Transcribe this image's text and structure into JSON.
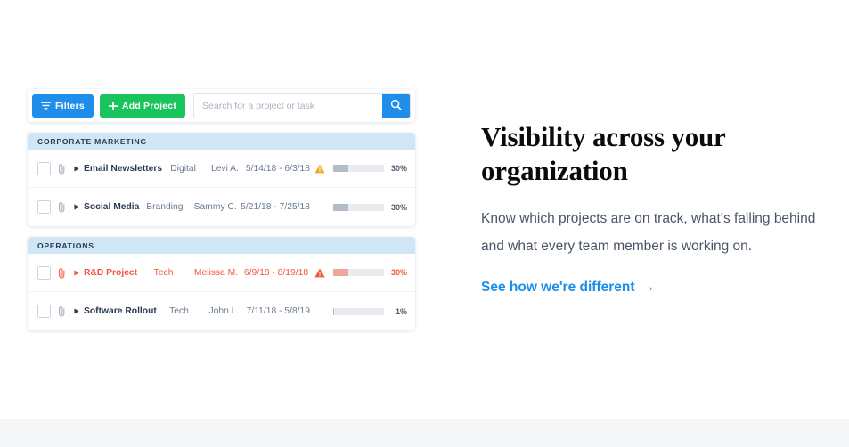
{
  "toolbar": {
    "filters_label": "Filters",
    "add_project_label": "Add Project",
    "search_placeholder": "Search for a project or task",
    "search_value": "",
    "filter_icon": "filter-icon",
    "plus_icon": "plus-icon",
    "search_icon": "search-icon"
  },
  "groups": [
    {
      "name": "CORPORATE MARKETING",
      "rows": [
        {
          "project": "Email Newsletters",
          "category": "Digital",
          "owner": "Levi A.",
          "dates": "5/14/18 - 6/3/18",
          "status": "warning",
          "status_icon": "warning-triangle-icon",
          "progress": 30,
          "progress_label": "30%",
          "danger": false
        },
        {
          "project": "Social Media",
          "category": "Branding",
          "owner": "Sammy C.",
          "dates": "5/21/18 - 7/25/18",
          "status": "none",
          "status_icon": "",
          "progress": 30,
          "progress_label": "30%",
          "danger": false
        }
      ]
    },
    {
      "name": "OPERATIONS",
      "rows": [
        {
          "project": "R&D Project",
          "category": "Tech",
          "owner": "Melissa M.",
          "dates": "6/9/18 - 8/19/18",
          "status": "danger",
          "status_icon": "warning-triangle-icon",
          "progress": 30,
          "progress_label": "30%",
          "danger": true
        },
        {
          "project": "Software Rollout",
          "category": "Tech",
          "owner": "John L.",
          "dates": "7/11/18 - 5/8/19",
          "status": "none",
          "status_icon": "",
          "progress": 1,
          "progress_label": "1%",
          "danger": false
        }
      ]
    }
  ],
  "copy": {
    "headline": "Visibility across your organization",
    "body": "Know which projects are on track, what’s falling behind and what every team member is working on.",
    "cta_label": "See how we're different",
    "cta_arrow": "→"
  },
  "colors": {
    "blue": "#1e8eea",
    "green": "#19c45c",
    "link_blue": "#1b8ee8",
    "danger_red": "#f4543c",
    "warning_orange": "#f5a623",
    "group_header_bg": "#cfe6f7",
    "text_dark": "#2b3a54",
    "text_muted": "#6a7b91",
    "band_gray": "#f4f6f8"
  }
}
